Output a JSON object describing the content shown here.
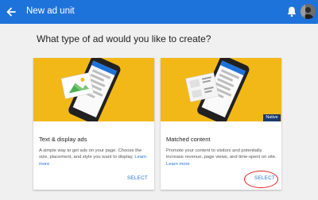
{
  "header": {
    "title": "New ad unit"
  },
  "heading": "What type of ad would you like to create?",
  "cards": [
    {
      "title": "Text & display ads",
      "description": "A simple way to get ads on your page. Choose the size, placement, and style you want to display.",
      "learn_more": "Learn more",
      "select": "SELECT"
    },
    {
      "title": "Matched content",
      "badge": "Native",
      "description": "Promote your content to visitors and potentially increase revenue, page views, and time-spent on site.",
      "learn_more": "Learn more",
      "select": "SELECT"
    }
  ],
  "colors": {
    "header": "#1e73db",
    "hero": "#f2b818",
    "accent": "#1e73db",
    "badge": "#1b3a6e",
    "annotation": "#e02020"
  },
  "icons": [
    "back-arrow-icon",
    "notifications-bell-icon",
    "account-avatar"
  ]
}
